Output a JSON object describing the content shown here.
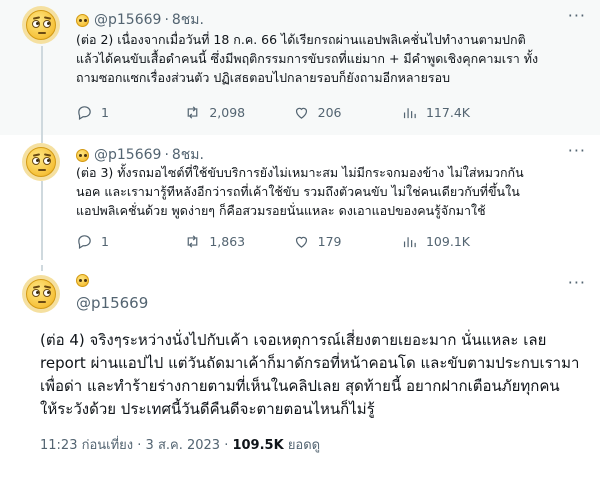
{
  "tweets": [
    {
      "handle": "@p15669",
      "time": "8ชม.",
      "text_lines": [
        "(ต่อ 2) เนื่องจากเมื่อวันที่ 18 ก.ค. 66 ได้เรียกรถผ่านแอปพลิเคชั่นไปทำงานตามปกติ",
        "แล้วได้คนขับเสื้อดำคนนี้ ซึ่งมีพฤติกรรมการขับรถที่แย่มาก + มีคำพูดเชิงคุกคามเรา ทั้ง",
        "ถามซอกแซกเรื่องส่วนตัว ปฏิเสธตอบไปกลายรอบก็ยังถามอีกหลายรอบ"
      ],
      "replies": "1",
      "retweets": "2,098",
      "likes": "206",
      "views": "117.4K"
    },
    {
      "handle": "@p15669",
      "time": "8ชม.",
      "text_lines": [
        "(ต่อ 3) ทั้งรถมอไซต์ที่ใช้ขับบริการยังไม่เหมาะสม ไม่มีกระจกมองข้าง ไม่ใส่หมวกกัน",
        "นอค และเรามารู้ทีหลังอีกว่ารถที่เค้าใช้ขับ รวมถึงตัวคนขับ ไม่ใช่คนเดียวกับที่ขึ้นใน",
        "แอปพลิเคชั่นด้วย พูดง่ายๆ ก็คือสวมรอยนั่นแหละ ดงเอาแอปของคนรู้จักมาใช้"
      ],
      "replies": "1",
      "retweets": "1,863",
      "likes": "179",
      "views": "109.1K"
    }
  ],
  "main_tweet": {
    "handle": "@p15669",
    "text_lines": [
      "(ต่อ 4) จริงๆระหว่างนั่งไปกับเค้า เจอเหตุการณ์เสี่ยงตายเยอะมาก นั่นแหละ เลย",
      "report ผ่านแอปไป แต่วันถัดมาเค้าก็มาดักรอที่หน้าคอนโด และขับตามประกบเรามา",
      "เพื่อด่า และทำร้ายร่างกายตามที่เห็นในคลิปเลย สุดท้ายนี้ อยากฝากเตือนภัยทุกคน",
      "ให้ระวังด้วย ประเทศนี้วันดีคืนดีจะตายตอนไหนก็ไม่รู้"
    ],
    "time": "11:23 ก่อนเที่ยง",
    "date": "3 ส.ค. 2023",
    "views": "109.5K",
    "views_label": "ยอดดู"
  },
  "icons": {
    "reply": "reply-icon",
    "retweet": "retweet-icon",
    "like": "heart-icon",
    "views": "views-chart-icon",
    "more": "more-icon"
  }
}
